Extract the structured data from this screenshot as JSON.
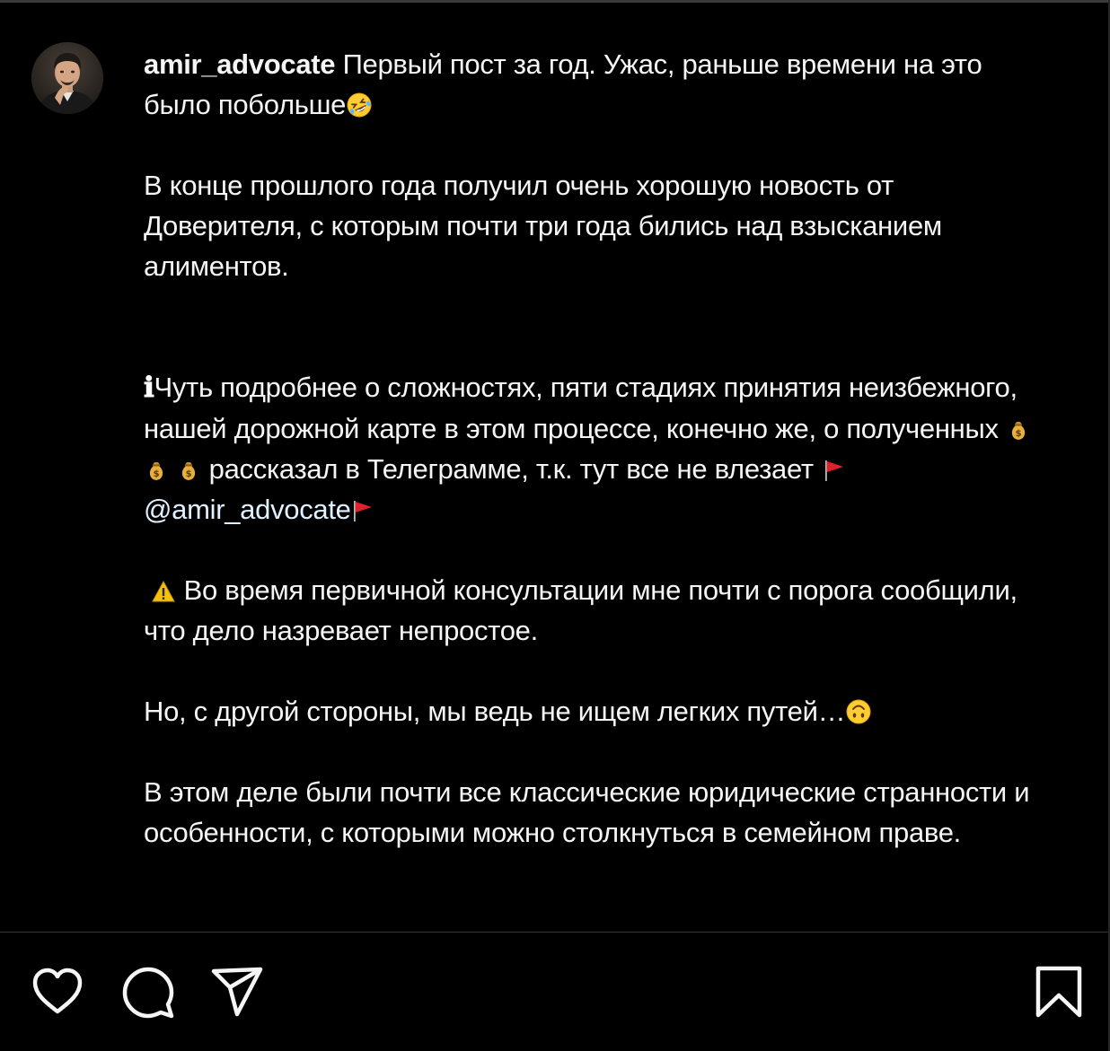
{
  "post": {
    "author": {
      "username": "amir_advocate",
      "avatar_icon": "profile-photo"
    },
    "caption": {
      "line1_text": "Первый пост за год. Ужас, раньше времени на это было побольше",
      "line1_emoji": "rolling-on-the-floor-laughing-emoji",
      "p2": "В конце прошлого года получил очень хорошую новость от Доверителя, с которым почти три года бились над взысканием алиментов.",
      "p3_info_icon": "ℹ",
      "p3_a": "Чуть подробнее о сложностях, пяти стадиях принятия неизбежного, нашей дорожной карте в этом процессе, конечно же, о полученных",
      "p3_money_emoji": "money-bag-emoji",
      "p3_b": "рассказал в Телеграмме, т.к. тут все не влезает",
      "p3_flag_emoji": "red-flag-emoji",
      "p3_mention": "@amir_advocate",
      "p4_warning_emoji": "warning-emoji",
      "p4": "Во время первичной консультации мне почти с порога сообщили, что дело назревает непростое.",
      "p5": "Но, с другой стороны, мы ведь не ищем легких путей…",
      "p5_emoji": "upside-down-face-emoji",
      "p6": "В этом деле были почти все классические юридические странности и особенности, с которыми можно столкнуться в семейном праве."
    }
  },
  "actions": {
    "like_icon": "heart-icon",
    "comment_icon": "comment-icon",
    "share_icon": "share-icon",
    "save_icon": "bookmark-icon"
  },
  "colors": {
    "background": "#000000",
    "text": "#f5f5f5",
    "mention": "#e0f1ff",
    "divider": "#363636"
  }
}
